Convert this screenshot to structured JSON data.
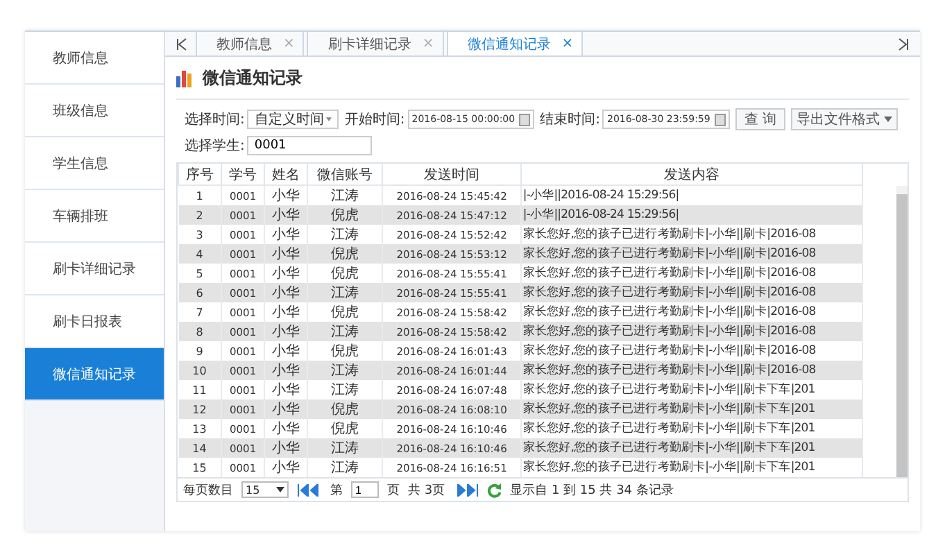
{
  "sidebar": {
    "items": [
      {
        "label": "教师信息",
        "selected": false
      },
      {
        "label": "班级信息",
        "selected": false
      },
      {
        "label": "学生信息",
        "selected": false
      },
      {
        "label": "车辆排班",
        "selected": false
      },
      {
        "label": "刷卡详细记录",
        "selected": false
      },
      {
        "label": "刷卡日报表",
        "selected": false
      },
      {
        "label": "微信通知记录",
        "selected": true
      }
    ]
  },
  "tabs": [
    {
      "label": "教师信息",
      "close": "×",
      "selected": false
    },
    {
      "label": "刷卡详细记录",
      "close": "×",
      "selected": false
    },
    {
      "label": "微信通知记录",
      "close": "×",
      "selected": true
    }
  ],
  "page_title": "微信通知记录",
  "filters": {
    "time_label": "选择时间:",
    "time_value": "自定义时间",
    "start_label": "开始时间:",
    "start_value": "2016-08-15 00:00:00",
    "end_label": "结束时间:",
    "end_value": "2016-08-30 23:59:59",
    "query_button": "查 询",
    "export_button": "导出文件格式",
    "student_label": "选择学生:",
    "student_value": "0001"
  },
  "table": {
    "columns": [
      "序号",
      "学号",
      "姓名",
      "微信账号",
      "发送时间",
      "发送内容"
    ],
    "rows": [
      [
        "1",
        "0001",
        "小华",
        "江涛",
        "2016-08-24 15:45:42",
        "|-小华||2016-08-24 15:29:56|"
      ],
      [
        "2",
        "0001",
        "小华",
        "倪虎",
        "2016-08-24 15:47:12",
        "|-小华||2016-08-24 15:29:56|"
      ],
      [
        "3",
        "0001",
        "小华",
        "江涛",
        "2016-08-24 15:52:42",
        "家长您好,您的孩子已进行考勤刷卡|-小华||刷卡|2016-08"
      ],
      [
        "4",
        "0001",
        "小华",
        "倪虎",
        "2016-08-24 15:53:12",
        "家长您好,您的孩子已进行考勤刷卡|-小华||刷卡|2016-08"
      ],
      [
        "5",
        "0001",
        "小华",
        "倪虎",
        "2016-08-24 15:55:41",
        "家长您好,您的孩子已进行考勤刷卡|-小华||刷卡|2016-08"
      ],
      [
        "6",
        "0001",
        "小华",
        "江涛",
        "2016-08-24 15:55:41",
        "家长您好,您的孩子已进行考勤刷卡|-小华||刷卡|2016-08"
      ],
      [
        "7",
        "0001",
        "小华",
        "倪虎",
        "2016-08-24 15:58:42",
        "家长您好,您的孩子已进行考勤刷卡|-小华||刷卡|2016-08"
      ],
      [
        "8",
        "0001",
        "小华",
        "江涛",
        "2016-08-24 15:58:42",
        "家长您好,您的孩子已进行考勤刷卡|-小华||刷卡|2016-08"
      ],
      [
        "9",
        "0001",
        "小华",
        "倪虎",
        "2016-08-24 16:01:43",
        "家长您好,您的孩子已进行考勤刷卡|-小华||刷卡|2016-08"
      ],
      [
        "10",
        "0001",
        "小华",
        "江涛",
        "2016-08-24 16:01:44",
        "家长您好,您的孩子已进行考勤刷卡|-小华||刷卡|2016-08"
      ],
      [
        "11",
        "0001",
        "小华",
        "江涛",
        "2016-08-24 16:07:48",
        "家长您好,您的孩子已进行考勤刷卡|-小华||刷卡下车|201"
      ],
      [
        "12",
        "0001",
        "小华",
        "倪虎",
        "2016-08-24 16:08:10",
        "家长您好,您的孩子已进行考勤刷卡|-小华||刷卡下车|201"
      ],
      [
        "13",
        "0001",
        "小华",
        "倪虎",
        "2016-08-24 16:10:46",
        "家长您好,您的孩子已进行考勤刷卡|-小华||刷卡下车|201"
      ],
      [
        "14",
        "0001",
        "小华",
        "江涛",
        "2016-08-24 16:10:46",
        "家长您好,您的孩子已进行考勤刷卡|-小华||刷卡下车|201"
      ],
      [
        "15",
        "0001",
        "小华",
        "江涛",
        "2016-08-24 16:16:51",
        "家长您好,您的孩子已进行考勤刷卡|-小华||刷卡下车|201"
      ]
    ]
  },
  "pager": {
    "per_page_label": "每页数目",
    "per_page_value": "15",
    "page_prefix": "第",
    "page_value": "1",
    "page_suffix": "页",
    "total_pages": "共 3页",
    "summary": "显示自 1 到 15 共 34 条记录"
  }
}
